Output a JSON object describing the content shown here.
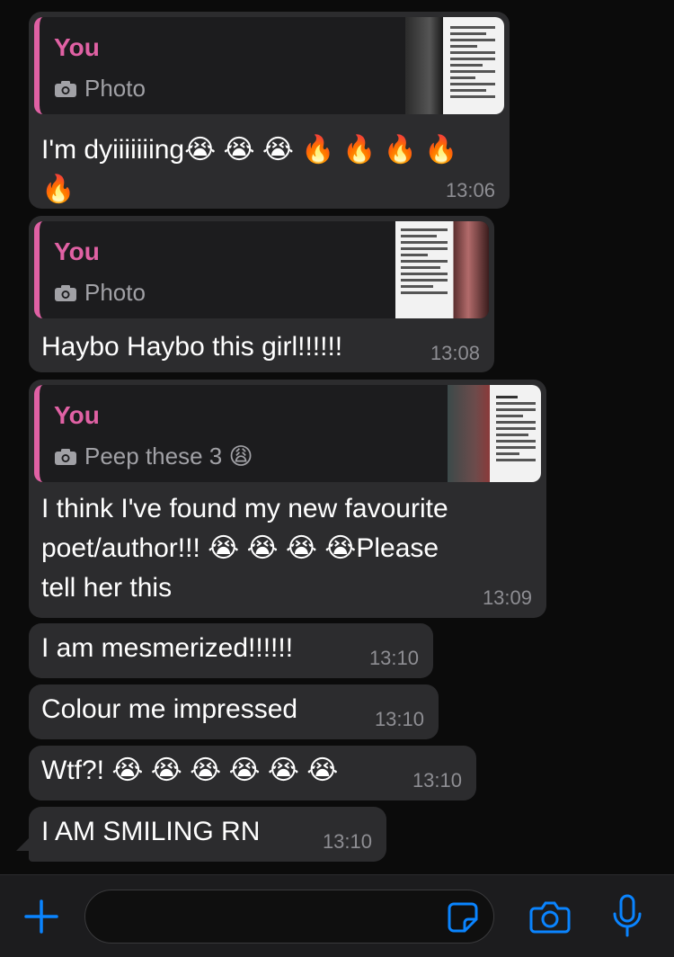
{
  "messages": [
    {
      "quote": {
        "author": "You",
        "label": "Photo"
      },
      "text": "I'm dyiiiiiiing😭 😭 😭 🔥 🔥 🔥 🔥\n🔥",
      "time": "13:06"
    },
    {
      "quote": {
        "author": "You",
        "label": "Photo"
      },
      "text": "Haybo Haybo this girl!!!!!!",
      "time": "13:08"
    },
    {
      "quote": {
        "author": "You",
        "label": "Peep these 3 😩"
      },
      "text": "I think I've found my new favourite\npoet/author!!! 😭 😭 😭 😭Please\ntell her this",
      "time": "13:09"
    },
    {
      "text": "I am mesmerized!!!!!!",
      "time": "13:10"
    },
    {
      "text": "Colour me impressed",
      "time": "13:10"
    },
    {
      "text": "Wtf?! 😭 😭 😭 😭 😭 😭",
      "time": "13:10"
    },
    {
      "text": "I AM SMILING RN",
      "time": "13:10"
    }
  ],
  "composer": {
    "icons": [
      "plus-icon",
      "sticker-icon",
      "camera-icon",
      "microphone-icon"
    ]
  },
  "colors": {
    "quote_accent": "#e061a4",
    "accent_blue": "#0a84ff",
    "bubble": "#2c2c2e"
  }
}
